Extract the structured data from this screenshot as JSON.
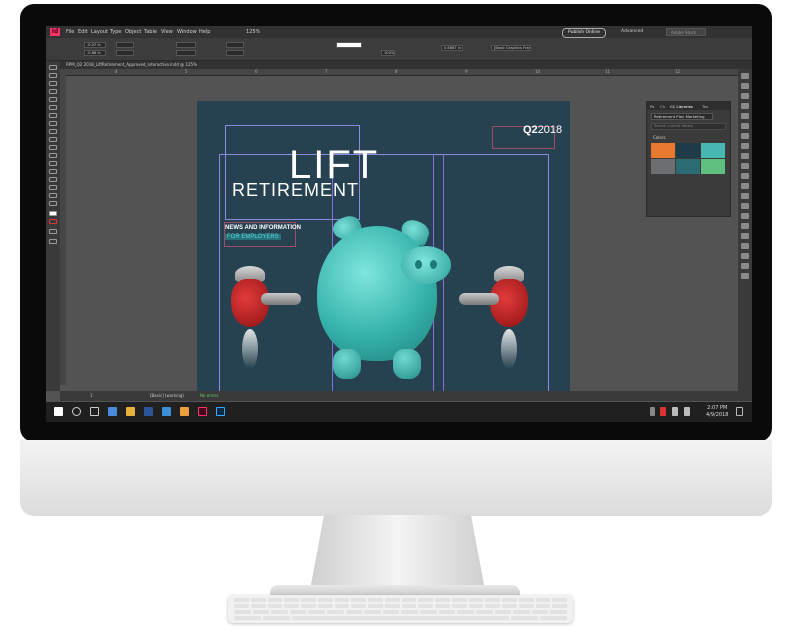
{
  "app": {
    "logo": "Id",
    "menu": [
      "File",
      "Edit",
      "Layout",
      "Type",
      "Object",
      "Table",
      "View",
      "Window",
      "Help"
    ],
    "zoom": "125%",
    "publish_label": "Publish Online",
    "workspace": "Advanced",
    "search_placeholder": "Adobe Stock",
    "frame_style": "[Basic Graphics Frame]+",
    "stroke_weight": "0.6667 in",
    "opacity": "100%",
    "document_tab": "RPM_Q2 2018_LiftRetirement_Approved_interactive.indd @ 125%",
    "field_x": "-0.07 in",
    "field_y": "-0.66 in",
    "ruler_ticks": [
      "4",
      "5",
      "6",
      "7",
      "8",
      "9",
      "10",
      "11",
      "12"
    ]
  },
  "status": {
    "page": "1",
    "style": "[Basic] (working)",
    "preflight": "No errors"
  },
  "document": {
    "issue_q": "Q2",
    "issue_year": "2018",
    "title_line1": "LIFT",
    "title_line2": "RETIREMENT",
    "tagline1": "NEWS AND INFORMATION",
    "tagline2": "FOR EMPLOYERS"
  },
  "libraries_panel": {
    "tabs": [
      "Pa",
      "Ch",
      "CC Libraries",
      "Tex"
    ],
    "active_tab": "CC Libraries",
    "library_name": "Retirement Plan Marketing",
    "search_placeholder": "Search current library",
    "section": "Colors",
    "swatches": [
      "#e8792e",
      "#1f3b4a",
      "#47b7b3",
      "#6d6e70",
      "#2b6b73",
      "#5fbf7f"
    ]
  },
  "taskbar": {
    "time": "2:07 PM",
    "date": "4/9/2018"
  }
}
